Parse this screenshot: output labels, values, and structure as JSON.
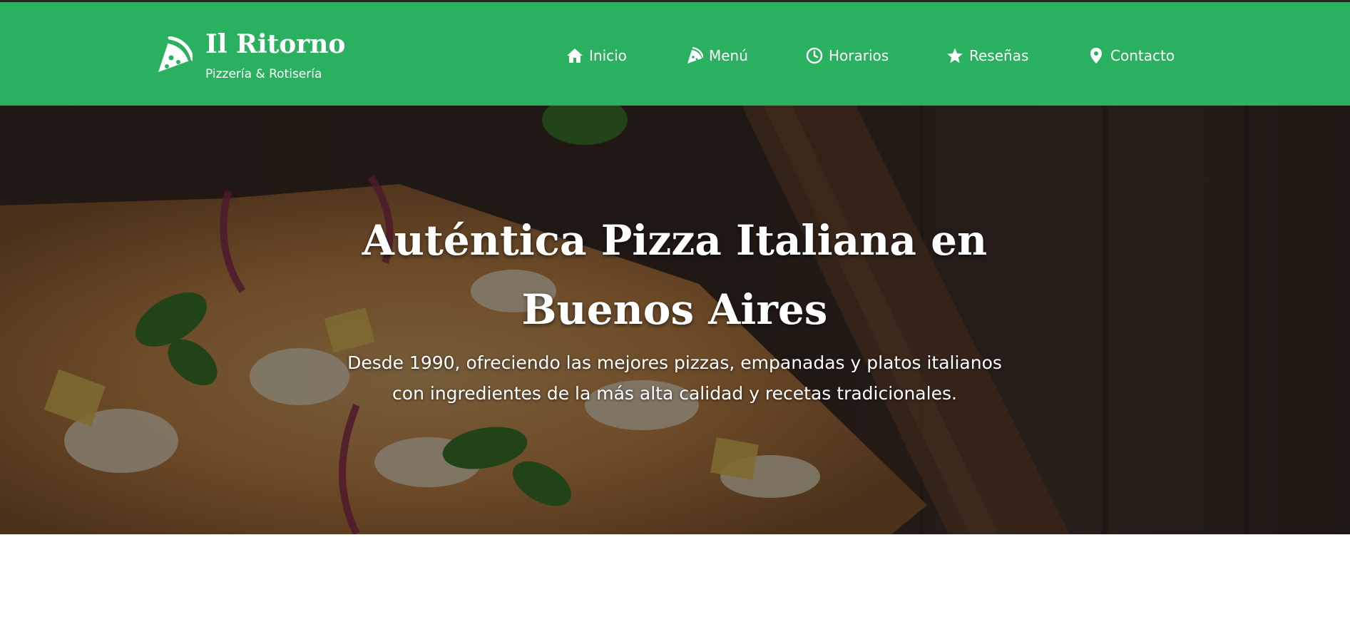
{
  "brand": {
    "name": "Il Ritorno",
    "subtitle": "Pizzería & Rotisería",
    "logo_icon": "pizza-slice-icon"
  },
  "nav": {
    "items": [
      {
        "label": "Inicio",
        "icon": "home-icon"
      },
      {
        "label": "Menú",
        "icon": "pizza-slice-icon"
      },
      {
        "label": "Horarios",
        "icon": "clock-icon"
      },
      {
        "label": "Reseñas",
        "icon": "star-icon"
      },
      {
        "label": "Contacto",
        "icon": "map-pin-icon"
      }
    ]
  },
  "hero": {
    "title_line1": "Auténtica Pizza Italiana en",
    "title_line2": "Buenos Aires",
    "desc_line1": "Desde 1990, ofreciendo las mejores pizzas, empanadas y platos italianos",
    "desc_line2": "con ingredientes de la más alta calidad y recetas tradicionales."
  },
  "colors": {
    "header_bg": "#2ab160",
    "text": "#ffffff",
    "hero_wood": "#3a2a22"
  }
}
